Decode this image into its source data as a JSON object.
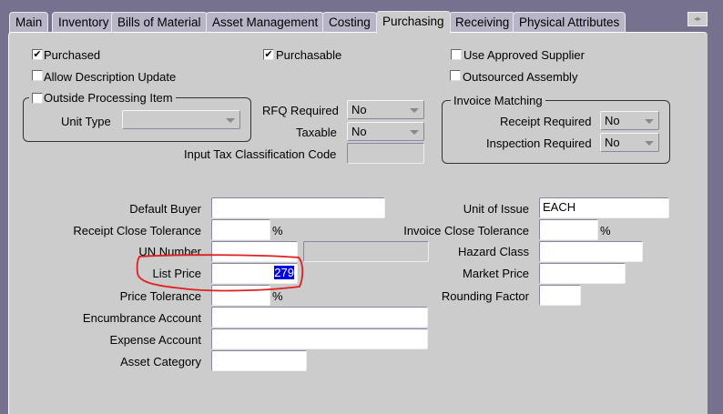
{
  "tabs": [
    "Main",
    "Inventory",
    "Bills of Material",
    "Asset Management",
    "Costing",
    "Purchasing",
    "Receiving",
    "Physical Attributes"
  ],
  "active_tab": "Purchasing",
  "checkboxes": {
    "purchased": {
      "label": "Purchased",
      "checked": true
    },
    "purchasable": {
      "label": "Purchasable",
      "checked": true
    },
    "use_approved_supplier": {
      "label": "Use Approved Supplier",
      "checked": false
    },
    "allow_description_update": {
      "label": "Allow Description Update",
      "checked": false
    },
    "outsourced_assembly": {
      "label": "Outsourced Assembly",
      "checked": false
    },
    "outside_processing_item": {
      "label": "Outside Processing Item",
      "checked": false
    }
  },
  "labels": {
    "unit_type": "Unit Type",
    "rfq_required": "RFQ Required",
    "taxable": "Taxable",
    "input_tax": "Input Tax Classification Code",
    "invoice_matching": "Invoice Matching",
    "receipt_required": "Receipt Required",
    "inspection_required": "Inspection Required",
    "default_buyer": "Default Buyer",
    "receipt_close_tolerance": "Receipt Close Tolerance",
    "un_number": "UN Number",
    "list_price": "List Price",
    "price_tolerance": "Price Tolerance",
    "encumbrance_account": "Encumbrance Account",
    "expense_account": "Expense Account",
    "asset_category": "Asset Category",
    "unit_of_issue": "Unit of Issue",
    "invoice_close_tolerance": "Invoice Close Tolerance",
    "hazard_class": "Hazard Class",
    "market_price": "Market Price",
    "rounding_factor": "Rounding Factor",
    "percent": "%"
  },
  "values": {
    "rfq_required": "No",
    "taxable": "No",
    "receipt_required": "No",
    "inspection_required": "No",
    "list_price": "279",
    "unit_of_issue": "EACH"
  },
  "check_glyph": "✔",
  "annotation_color": "#e02020"
}
